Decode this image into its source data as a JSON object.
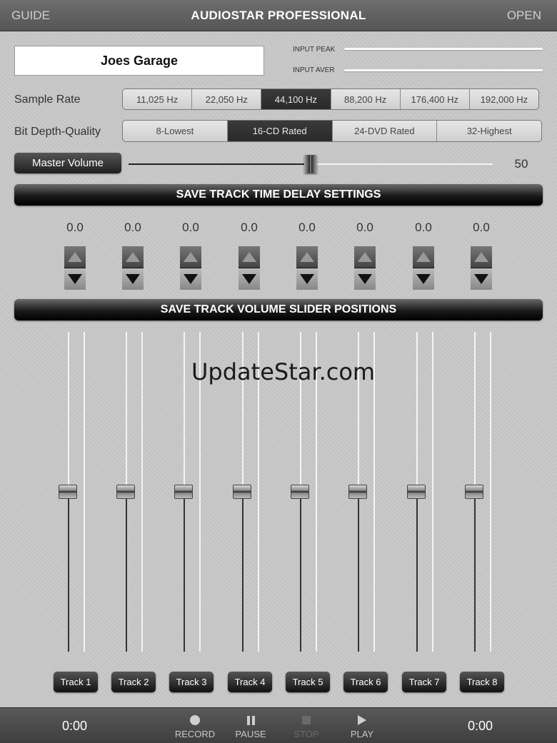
{
  "topbar": {
    "guide": "GUIDE",
    "title": "AUDIOSTAR PROFESSIONAL",
    "open": "OPEN"
  },
  "session": {
    "name": "Joes Garage"
  },
  "meters": {
    "peak_label": "INPUT PEAK",
    "aver_label": "INPUT AVER"
  },
  "sample_rate": {
    "label": "Sample Rate",
    "options": [
      "11,025 Hz",
      "22,050 Hz",
      "44,100 Hz",
      "88,200 Hz",
      "176,400 Hz",
      "192,000 Hz"
    ],
    "selected": "44,100 Hz"
  },
  "bit_depth": {
    "label": "Bit Depth-Quality",
    "options": [
      "8-Lowest",
      "16-CD Rated",
      "24-DVD Rated",
      "32-Highest"
    ],
    "selected": "16-CD Rated"
  },
  "master": {
    "label": "Master Volume",
    "value": "50",
    "level": 0.5
  },
  "save_delay_label": "SAVE TRACK TIME DELAY SETTINGS",
  "save_volume_label": "SAVE TRACK VOLUME SLIDER POSITIONS",
  "delays": [
    "0.0",
    "0.0",
    "0.0",
    "0.0",
    "0.0",
    "0.0",
    "0.0",
    "0.0"
  ],
  "tracks": [
    {
      "label": "Track 1",
      "level": 0.5
    },
    {
      "label": "Track 2",
      "level": 0.5
    },
    {
      "label": "Track 3",
      "level": 0.5
    },
    {
      "label": "Track 4",
      "level": 0.5
    },
    {
      "label": "Track 5",
      "level": 0.5
    },
    {
      "label": "Track 6",
      "level": 0.5
    },
    {
      "label": "Track 7",
      "level": 0.5
    },
    {
      "label": "Track 8",
      "level": 0.5
    }
  ],
  "watermark": "UpdateStar.com",
  "bottombar": {
    "time_left": "0:00",
    "time_right": "0:00",
    "record": "RECORD",
    "pause": "PAUSE",
    "stop": "STOP",
    "play": "PLAY"
  }
}
